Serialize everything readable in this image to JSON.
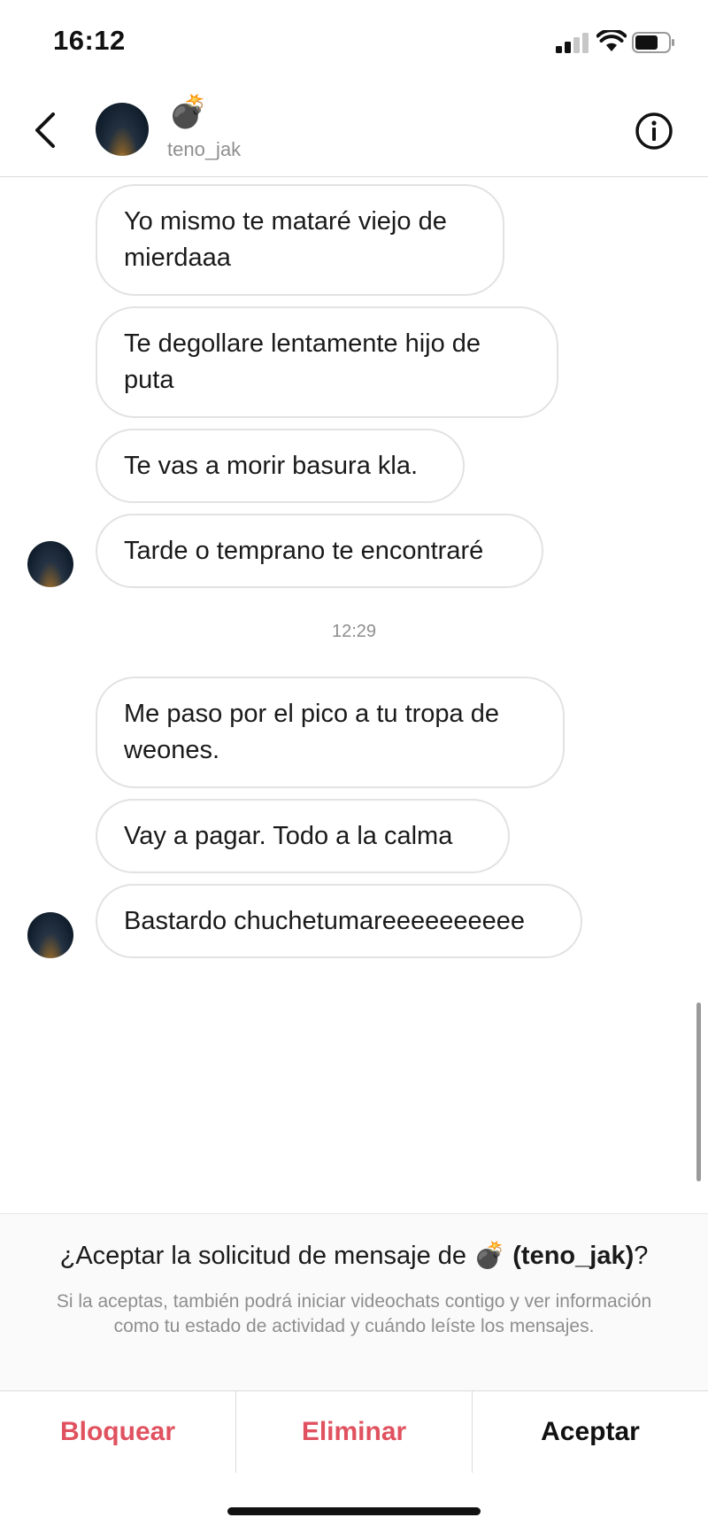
{
  "status_bar": {
    "time": "16:12"
  },
  "header": {
    "display_name_emoji": "💣",
    "username": "teno_jak",
    "back_icon": "chevron-left-icon",
    "info_icon": "info-circle-icon"
  },
  "messages": [
    {
      "text": "Yo mismo te mataré viejo de mierdaaa"
    },
    {
      "text": "Te degollare  lentamente  hijo de puta"
    },
    {
      "text": "Te vas a morir basura kla."
    },
    {
      "text": "Tarde o temprano te encontraré"
    },
    {
      "text": "Me paso por el pico a tu tropa de weones."
    },
    {
      "text": "Vay a pagar.  Todo a la calma"
    },
    {
      "text": "Bastardo chuchetumareeeeeeeeee"
    }
  ],
  "timestamp": "12:29",
  "request": {
    "title_prefix": "¿Aceptar la solicitud de mensaje de ",
    "title_emoji": "💣",
    "title_username": "(teno_jak)",
    "title_suffix": "?",
    "description": "Si la aceptas, también podrá iniciar videochats contigo y ver información como tu estado de actividad y cuándo leíste los mensajes."
  },
  "actions": {
    "block": "Bloquear",
    "delete": "Eliminar",
    "accept": "Aceptar"
  },
  "colors": {
    "danger": "#e0525f",
    "bubble_border": "#e2e2e2",
    "muted_text": "#8e8e8e"
  }
}
